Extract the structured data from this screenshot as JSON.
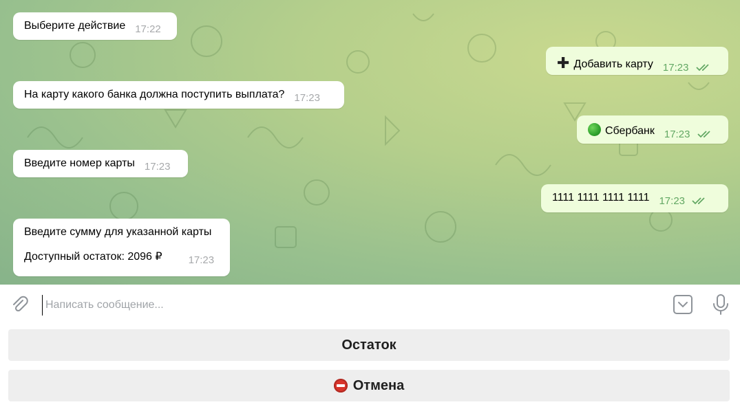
{
  "messages": [
    {
      "dir": "in",
      "text": "Выберите действие",
      "time": "17:22"
    },
    {
      "dir": "out",
      "icon": "plus-icon",
      "text": "Добавить карту",
      "time": "17:23"
    },
    {
      "dir": "in",
      "text": "На карту какого банка должна поступить выплата?",
      "time": "17:23"
    },
    {
      "dir": "out",
      "icon": "green-circle-icon",
      "text": "Сбербанк",
      "time": "17:23"
    },
    {
      "dir": "in",
      "text": "Введите номер карты",
      "time": "17:23"
    },
    {
      "dir": "out",
      "text": "1111 1111 1111 1111",
      "time": "17:23"
    },
    {
      "dir": "in",
      "line1": "Введите сумму для указанной карты",
      "line2": "Доступный остаток: 2096 ₽",
      "time": "17:23"
    }
  ],
  "composer": {
    "placeholder": "Написать сообщение...",
    "attach_icon": "paperclip-icon",
    "keyboard_icon": "keyboard-toggle-icon",
    "mic_icon": "microphone-icon"
  },
  "keyboard": {
    "buttons": [
      {
        "label": "Остаток"
      },
      {
        "icon": "no-entry-icon",
        "label": "Отмена"
      }
    ]
  },
  "colors": {
    "incoming_bubble": "#ffffff",
    "outgoing_bubble": "#effddc",
    "outgoing_time": "#63a864",
    "button_bg": "#eeeeee"
  }
}
